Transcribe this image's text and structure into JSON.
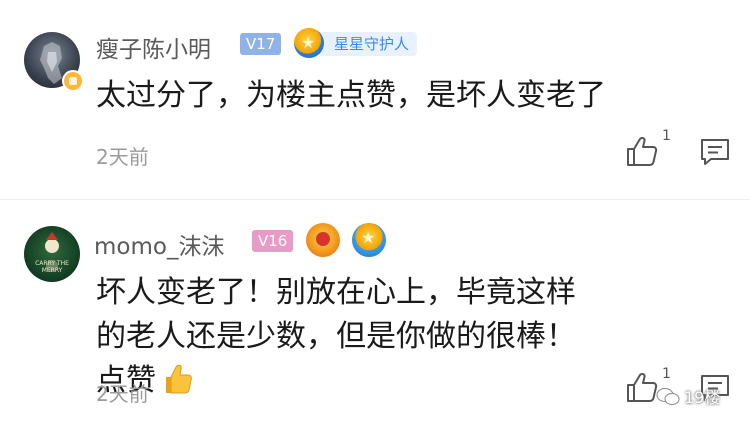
{
  "comments": [
    {
      "username": "瘦子陈小明",
      "level": "V17",
      "badge": "星星守护人",
      "text": "太过分了，为楼主点赞，是坏人变老了",
      "time": "2天前",
      "likes": "1"
    },
    {
      "username": "momo_沫沫",
      "level": "V16",
      "avatar_text": "CARRY THE MERRY",
      "text": "坏人变老了！别放在心上，毕竟这样的老人还是少数，但是你做的很棒！点赞",
      "time": "2天前",
      "likes": "1"
    }
  ],
  "watermark": "19楼",
  "colors": {
    "level_v17": "#8fb3e6",
    "level_v16": "#e99bc7",
    "badge_text": "#3d8be0",
    "username": "#5a5a5a",
    "time": "#9b9b9b"
  },
  "icons": {
    "like": "thumbs-up-outline-icon",
    "reply": "comment-bubble-icon",
    "emoji": "thumbs-up-emoji"
  }
}
